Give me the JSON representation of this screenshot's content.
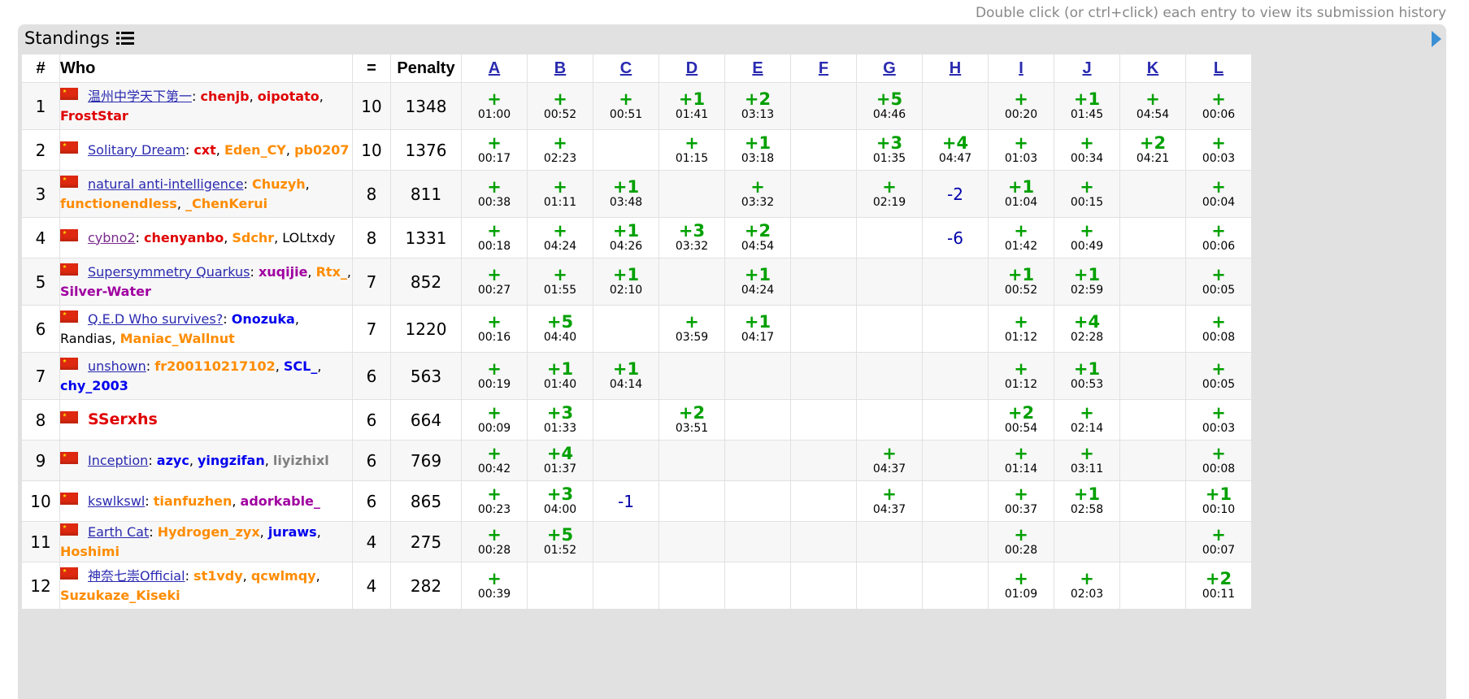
{
  "hint": "Double click (or ctrl+click) each entry to view its submission history",
  "title": "Standings",
  "headers": {
    "rank": "#",
    "who": "Who",
    "solved": "=",
    "penalty": "Penalty",
    "problems": [
      "A",
      "B",
      "C",
      "D",
      "E",
      "F",
      "G",
      "H",
      "I",
      "J",
      "K",
      "L"
    ]
  },
  "rows": [
    {
      "rank": "1",
      "team": "温州中学天下第一",
      "team_style": "link",
      "members": [
        [
          "chenjb",
          "red"
        ],
        [
          "oipotato",
          "red"
        ],
        [
          "FrostStar",
          "red"
        ]
      ],
      "solved": "10",
      "penalty": "1348",
      "cells": [
        [
          "+",
          "01:00"
        ],
        [
          "+",
          "00:52"
        ],
        [
          "+",
          "00:51"
        ],
        [
          "+1",
          "01:41"
        ],
        [
          "+2",
          "03:13"
        ],
        [
          "",
          ""
        ],
        [
          "+5",
          "04:46"
        ],
        [
          "",
          ""
        ],
        [
          "+",
          "00:20"
        ],
        [
          "+1",
          "01:45"
        ],
        [
          "+",
          "04:54"
        ],
        [
          "+",
          "00:06"
        ]
      ]
    },
    {
      "rank": "2",
      "team": "Solitary Dream",
      "team_style": "link",
      "members": [
        [
          "cxt",
          "red"
        ],
        [
          "Eden_CY",
          "orange"
        ],
        [
          "pb0207",
          "orange"
        ]
      ],
      "solved": "10",
      "penalty": "1376",
      "cells": [
        [
          "+",
          "00:17"
        ],
        [
          "+",
          "02:23"
        ],
        [
          "",
          ""
        ],
        [
          "+",
          "01:15"
        ],
        [
          "+1",
          "03:18"
        ],
        [
          "",
          ""
        ],
        [
          "+3",
          "01:35"
        ],
        [
          "+4",
          "04:47"
        ],
        [
          "+",
          "01:03"
        ],
        [
          "+",
          "00:34"
        ],
        [
          "+2",
          "04:21"
        ],
        [
          "+",
          "00:03"
        ]
      ]
    },
    {
      "rank": "3",
      "team": "natural anti-intelligence",
      "team_style": "link",
      "members": [
        [
          "Chuzyh",
          "orange"
        ],
        [
          "functionendless",
          "orange"
        ],
        [
          "_ChenKerui",
          "orange"
        ]
      ],
      "solved": "8",
      "penalty": "811",
      "cells": [
        [
          "+",
          "00:38"
        ],
        [
          "+",
          "01:11"
        ],
        [
          "+1",
          "03:48"
        ],
        [
          "",
          ""
        ],
        [
          "+",
          "03:32"
        ],
        [
          "",
          ""
        ],
        [
          "+",
          "02:19"
        ],
        [
          "-2",
          ""
        ],
        [
          "+1",
          "01:04"
        ],
        [
          "+",
          "00:15"
        ],
        [
          "",
          ""
        ],
        [
          "+",
          "00:04"
        ]
      ]
    },
    {
      "rank": "4",
      "team": "cybno2",
      "team_style": "visited",
      "members": [
        [
          "chenyanbo",
          "red"
        ],
        [
          "Sdchr",
          "orange"
        ],
        [
          "LOLtxdy",
          "black"
        ]
      ],
      "solved": "8",
      "penalty": "1331",
      "cells": [
        [
          "+",
          "00:18"
        ],
        [
          "+",
          "04:24"
        ],
        [
          "+1",
          "04:26"
        ],
        [
          "+3",
          "03:32"
        ],
        [
          "+2",
          "04:54"
        ],
        [
          "",
          ""
        ],
        [
          "",
          ""
        ],
        [
          "-6",
          ""
        ],
        [
          "+",
          "01:42"
        ],
        [
          "+",
          "00:49"
        ],
        [
          "",
          ""
        ],
        [
          "+",
          "00:06"
        ]
      ]
    },
    {
      "rank": "5",
      "team": "Supersymmetry Quarkus",
      "team_style": "link",
      "members": [
        [
          "xuqijie",
          "purple"
        ],
        [
          "Rtx_",
          "orange"
        ],
        [
          "Silver-Water",
          "purple"
        ]
      ],
      "solved": "7",
      "penalty": "852",
      "cells": [
        [
          "+",
          "00:27"
        ],
        [
          "+",
          "01:55"
        ],
        [
          "+1",
          "02:10"
        ],
        [
          "",
          ""
        ],
        [
          "+1",
          "04:24"
        ],
        [
          "",
          ""
        ],
        [
          "",
          ""
        ],
        [
          "",
          ""
        ],
        [
          "+1",
          "00:52"
        ],
        [
          "+1",
          "02:59"
        ],
        [
          "",
          ""
        ],
        [
          "+",
          "00:05"
        ]
      ]
    },
    {
      "rank": "6",
      "team": "Q.E.D Who survives?",
      "team_style": "link",
      "members": [
        [
          "Onozuka",
          "blue"
        ],
        [
          "Randias",
          "black"
        ],
        [
          "Maniac_Wallnut",
          "orange"
        ]
      ],
      "solved": "7",
      "penalty": "1220",
      "cells": [
        [
          "+",
          "00:16"
        ],
        [
          "+5",
          "04:40"
        ],
        [
          "",
          ""
        ],
        [
          "+",
          "03:59"
        ],
        [
          "+1",
          "04:17"
        ],
        [
          "",
          ""
        ],
        [
          "",
          ""
        ],
        [
          "",
          ""
        ],
        [
          "+",
          "01:12"
        ],
        [
          "+4",
          "02:28"
        ],
        [
          "",
          ""
        ],
        [
          "+",
          "00:08"
        ]
      ]
    },
    {
      "rank": "7",
      "team": "unshown",
      "team_style": "link",
      "members": [
        [
          "fr200110217102",
          "orange"
        ],
        [
          "SCL_",
          "blue"
        ],
        [
          "chy_2003",
          "blue"
        ]
      ],
      "solved": "6",
      "penalty": "563",
      "cells": [
        [
          "+",
          "00:19"
        ],
        [
          "+1",
          "01:40"
        ],
        [
          "+1",
          "04:14"
        ],
        [
          "",
          ""
        ],
        [
          "",
          ""
        ],
        [
          "",
          ""
        ],
        [
          "",
          ""
        ],
        [
          "",
          ""
        ],
        [
          "+",
          "01:12"
        ],
        [
          "+1",
          "00:53"
        ],
        [
          "",
          ""
        ],
        [
          "+",
          "00:05"
        ]
      ]
    },
    {
      "rank": "8",
      "team": "SSerxhs",
      "team_style": "solo",
      "members": [],
      "solved": "6",
      "penalty": "664",
      "cells": [
        [
          "+",
          "00:09"
        ],
        [
          "+3",
          "01:33"
        ],
        [
          "",
          ""
        ],
        [
          "+2",
          "03:51"
        ],
        [
          "",
          ""
        ],
        [
          "",
          ""
        ],
        [
          "",
          ""
        ],
        [
          "",
          ""
        ],
        [
          "+2",
          "00:54"
        ],
        [
          "+",
          "02:14"
        ],
        [
          "",
          ""
        ],
        [
          "+",
          "00:03"
        ]
      ]
    },
    {
      "rank": "9",
      "team": "Inception",
      "team_style": "link",
      "members": [
        [
          "azyc",
          "blue"
        ],
        [
          "yingzifan",
          "blue"
        ],
        [
          "liyizhixl",
          "gray"
        ]
      ],
      "solved": "6",
      "penalty": "769",
      "cells": [
        [
          "+",
          "00:42"
        ],
        [
          "+4",
          "01:37"
        ],
        [
          "",
          ""
        ],
        [
          "",
          ""
        ],
        [
          "",
          ""
        ],
        [
          "",
          ""
        ],
        [
          "+",
          "04:37"
        ],
        [
          "",
          ""
        ],
        [
          "+",
          "01:14"
        ],
        [
          "+",
          "03:11"
        ],
        [
          "",
          ""
        ],
        [
          "+",
          "00:08"
        ]
      ]
    },
    {
      "rank": "10",
      "team": "kswlkswl",
      "team_style": "link",
      "members": [
        [
          "tianfuzhen",
          "orange"
        ],
        [
          "adorkable_",
          "purple"
        ]
      ],
      "solved": "6",
      "penalty": "865",
      "cells": [
        [
          "+",
          "00:23"
        ],
        [
          "+3",
          "04:00"
        ],
        [
          "-1",
          ""
        ],
        [
          "",
          ""
        ],
        [
          "",
          ""
        ],
        [
          "",
          ""
        ],
        [
          "+",
          "04:37"
        ],
        [
          "",
          ""
        ],
        [
          "+",
          "00:37"
        ],
        [
          "+1",
          "02:58"
        ],
        [
          "",
          ""
        ],
        [
          "+1",
          "00:10"
        ]
      ]
    },
    {
      "rank": "11",
      "team": "Earth Cat",
      "team_style": "link",
      "members": [
        [
          "Hydrogen_zyx",
          "orange"
        ],
        [
          "juraws",
          "blue"
        ],
        [
          "Hoshimi",
          "orange"
        ]
      ],
      "solved": "4",
      "penalty": "275",
      "cells": [
        [
          "+",
          "00:28"
        ],
        [
          "+5",
          "01:52"
        ],
        [
          "",
          ""
        ],
        [
          "",
          ""
        ],
        [
          "",
          ""
        ],
        [
          "",
          ""
        ],
        [
          "",
          ""
        ],
        [
          "",
          ""
        ],
        [
          "+",
          "00:28"
        ],
        [
          "",
          ""
        ],
        [
          "",
          ""
        ],
        [
          "+",
          "00:07"
        ]
      ]
    },
    {
      "rank": "12",
      "team": "神奈七崇Official",
      "team_style": "link",
      "members": [
        [
          "st1vdy",
          "orange"
        ],
        [
          "qcwlmqy",
          "orange"
        ],
        [
          "Suzukaze_Kiseki",
          "orange"
        ]
      ],
      "solved": "4",
      "penalty": "282",
      "cells": [
        [
          "+",
          "00:39"
        ],
        [
          "",
          ""
        ],
        [
          "",
          ""
        ],
        [
          "",
          ""
        ],
        [
          "",
          ""
        ],
        [
          "",
          ""
        ],
        [
          "",
          ""
        ],
        [
          "",
          ""
        ],
        [
          "+",
          "01:09"
        ],
        [
          "+",
          "02:03"
        ],
        [
          "",
          ""
        ],
        [
          "+2",
          "00:11"
        ]
      ]
    }
  ]
}
